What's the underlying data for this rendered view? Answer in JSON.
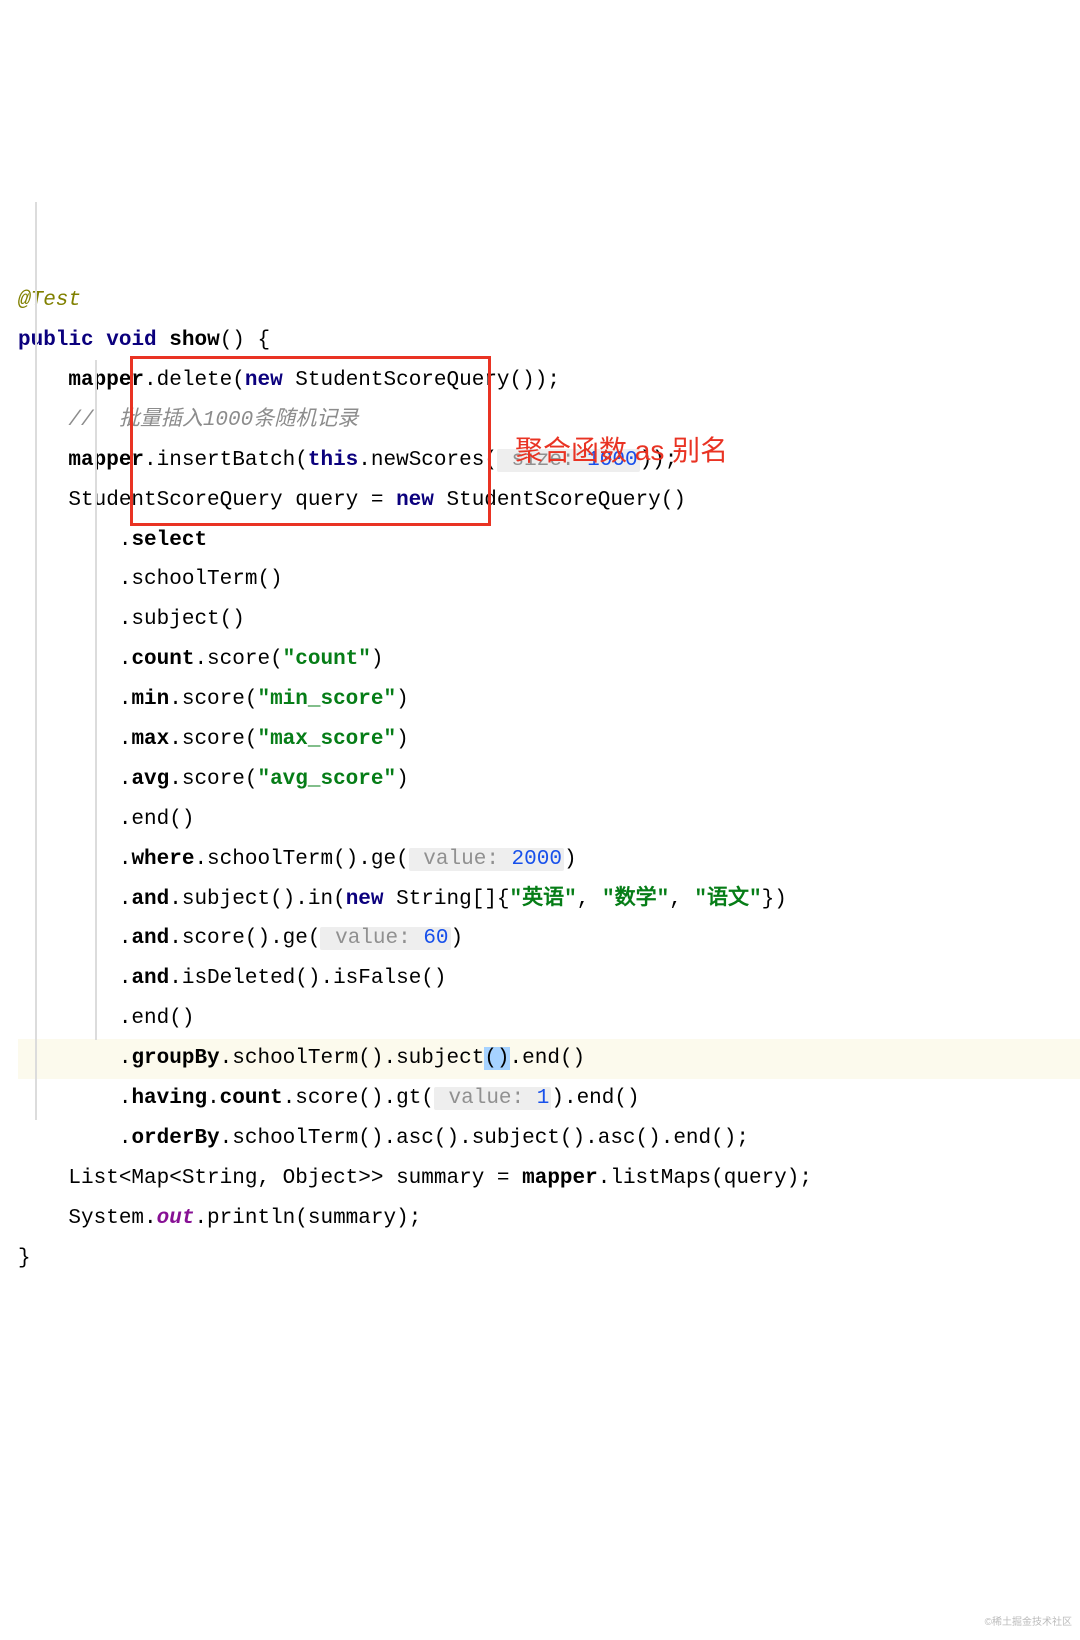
{
  "annotation_text": "聚合函数 as 别名",
  "watermark": "©稀土掘金技术社区",
  "code": {
    "l0": "@Test",
    "l1_kw1": "public",
    "l1_kw2": "void",
    "l1_name": "show",
    "l1_tail": "() {",
    "l2_a": "mapper",
    "l2_b": ".delete(",
    "l2_kw": "new",
    "l2_c": " StudentScoreQuery());",
    "l3": "//  批量插入1000条随机记录",
    "l4_a": "mapper",
    "l4_b": ".insertBatch(",
    "l4_kw": "this",
    "l4_c": ".newScores(",
    "l4_hl": " size: ",
    "l4_num": "1000",
    "l4_d": "));",
    "l5_a": "StudentScoreQuery query = ",
    "l5_kw": "new",
    "l5_b": " StudentScoreQuery()",
    "l6_a": ".",
    "l6_b": "select",
    "l7": ".schoolTerm()",
    "l8": ".subject()",
    "l9_a": ".",
    "l9_b": "count",
    "l9_c": ".score(",
    "l9_s": "\"count\"",
    "l9_d": ")",
    "l10_a": ".",
    "l10_b": "min",
    "l10_c": ".score(",
    "l10_s": "\"min_score\"",
    "l10_d": ")",
    "l11_a": ".",
    "l11_b": "max",
    "l11_c": ".score(",
    "l11_s": "\"max_score\"",
    "l11_d": ")",
    "l12_a": ".",
    "l12_b": "avg",
    "l12_c": ".score(",
    "l12_s": "\"avg_score\"",
    "l12_d": ")",
    "l13": ".end()",
    "l14_a": ".",
    "l14_b": "where",
    "l14_c": ".schoolTerm().ge(",
    "l14_hl": " value: ",
    "l14_num": "2000",
    "l14_d": ")",
    "l15_a": ".",
    "l15_b": "and",
    "l15_c": ".subject().in(",
    "l15_kw": "new",
    "l15_d": " String[]{",
    "l15_s1": "\"英语\"",
    "l15_s2": "\"数学\"",
    "l15_s3": "\"语文\"",
    "l15_e": "})",
    "l16_a": ".",
    "l16_b": "and",
    "l16_c": ".score().ge(",
    "l16_hl": " value: ",
    "l16_num": "60",
    "l16_d": ")",
    "l17_a": ".",
    "l17_b": "and",
    "l17_c": ".isDeleted().isFalse()",
    "l18": ".end()",
    "l19_a": ".",
    "l19_b": "groupBy",
    "l19_c": ".schoolTerm().subject",
    "l19_p1": "(",
    "l19_p2": ")",
    "l19_d": ".end()",
    "l20_a": ".",
    "l20_b": "having",
    "l20_c": ".",
    "l20_d": "count",
    "l20_e": ".score().gt(",
    "l20_hl": " value: ",
    "l20_num": "1",
    "l20_f": ").end()",
    "l21_a": ".",
    "l21_b": "orderBy",
    "l21_c": ".schoolTerm().asc().subject().asc().end();",
    "l22_a": "List<Map<String, Object>> summary = ",
    "l22_b": "mapper",
    "l22_c": ".listMaps(query);",
    "l23_a": "System.",
    "l23_b": "out",
    "l23_c": ".println(summary);",
    "l24": "}"
  }
}
